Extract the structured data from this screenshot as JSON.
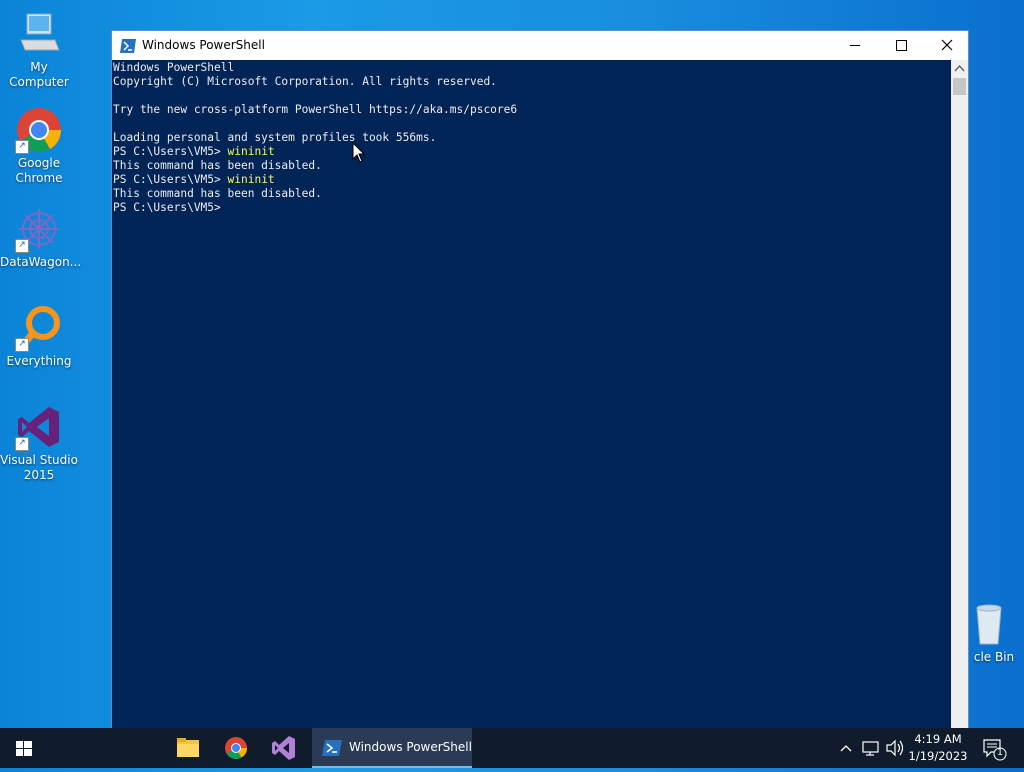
{
  "desktop": {
    "icons": [
      {
        "label": "My Computer"
      },
      {
        "label": "Google Chrome"
      },
      {
        "label": "DataWagon..."
      },
      {
        "label": "Everything"
      },
      {
        "label": "Visual Studio 2015"
      },
      {
        "label": "cle Bin"
      }
    ]
  },
  "window": {
    "title": "Windows PowerShell",
    "console_lines": [
      {
        "text": "Windows PowerShell"
      },
      {
        "text": "Copyright (C) Microsoft Corporation. All rights reserved."
      },
      {
        "text": ""
      },
      {
        "text": "Try the new cross-platform PowerShell https://aka.ms/pscore6"
      },
      {
        "text": ""
      },
      {
        "text": "Loading personal and system profiles took 556ms."
      },
      {
        "prompt": "PS C:\\Users\\VM5> ",
        "command": "wininit"
      },
      {
        "text": "This command has been disabled."
      },
      {
        "prompt": "PS C:\\Users\\VM5> ",
        "command": "wininit"
      },
      {
        "text": "This command has been disabled."
      },
      {
        "prompt": "PS C:\\Users\\VM5>",
        "command": ""
      }
    ]
  },
  "taskbar": {
    "active_app_label": "Windows PowerShell",
    "clock": {
      "time": "4:19 AM",
      "date": "1/19/2023"
    },
    "notification_count": "1"
  },
  "colors": {
    "console_bg": "#012456",
    "console_text": "#eeedf0",
    "command_text": "#fcf85a",
    "taskbar_bg": "#101c2c"
  }
}
